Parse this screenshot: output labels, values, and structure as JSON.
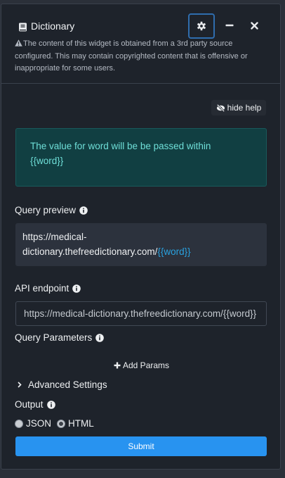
{
  "widget": {
    "title": "Dictionary",
    "notice": "The content of this widget is obtained from a 3rd party source configured. This may contain copyrighted content that is offensive or inappropriate for some users."
  },
  "help": {
    "toggle_label": "hide help",
    "message_line1": "The value for word will be be passed within",
    "message_line2": "{{word}}"
  },
  "query_preview": {
    "label": "Query preview",
    "url_prefix_line1": "https://medical-",
    "url_prefix_line2": "dictionary.thefreedictionary.com/",
    "url_variable": "{{word}}"
  },
  "api_endpoint": {
    "label": "API endpoint",
    "value": "https://medical-dictionary.thefreedictionary.com/{{word}}"
  },
  "query_parameters": {
    "label": "Query Parameters",
    "add_label": "Add Params"
  },
  "advanced_settings": {
    "label": "Advanced Settings"
  },
  "output": {
    "label": "Output",
    "options": [
      "JSON",
      "HTML"
    ],
    "selected": "HTML"
  },
  "submit_label": "Submit",
  "colors": {
    "accent": "#2893f0",
    "variable": "#29a2e0",
    "help_text": "#6fdfd8",
    "help_bg": "#113f42"
  }
}
